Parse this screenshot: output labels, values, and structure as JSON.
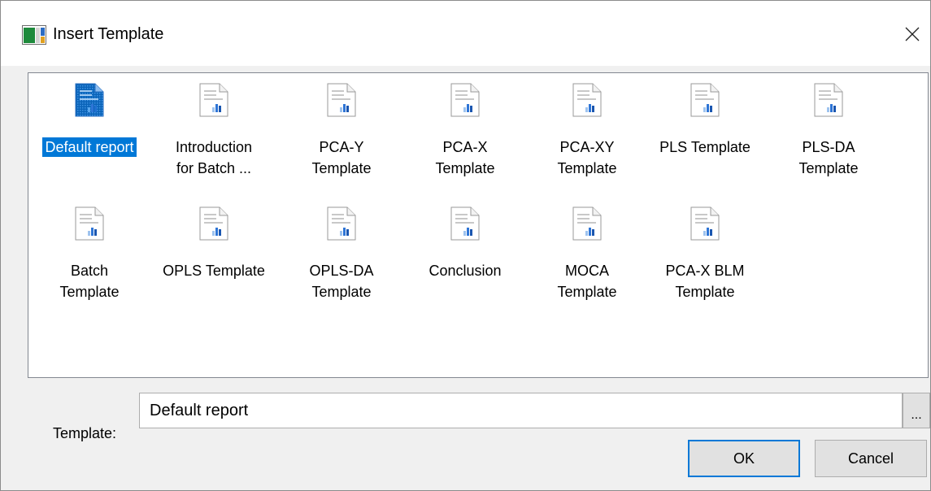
{
  "window": {
    "title": "Insert Template"
  },
  "templates": [
    {
      "label": "Default report",
      "selected": true
    },
    {
      "label": "Introduction\nfor Batch ..."
    },
    {
      "label": "PCA-Y\nTemplate"
    },
    {
      "label": "PCA-X\nTemplate"
    },
    {
      "label": "PCA-XY\nTemplate"
    },
    {
      "label": "PLS Template"
    },
    {
      "label": "PLS-DA\nTemplate"
    },
    {
      "label": "Batch\nTemplate"
    },
    {
      "label": "OPLS Template"
    },
    {
      "label": "OPLS-DA\nTemplate"
    },
    {
      "label": "Conclusion"
    },
    {
      "label": "MOCA\nTemplate"
    },
    {
      "label": "PCA-X BLM\nTemplate"
    }
  ],
  "form": {
    "template_label": "Template:",
    "template_value": "Default report",
    "browse_label": "..."
  },
  "buttons": {
    "ok": "OK",
    "cancel": "Cancel"
  },
  "icons": {
    "app": "report-app-icon",
    "close": "close-icon",
    "document": "document-chart-icon"
  },
  "colors": {
    "selection": "#0078d7",
    "chart_bar": "#2e75d6"
  }
}
